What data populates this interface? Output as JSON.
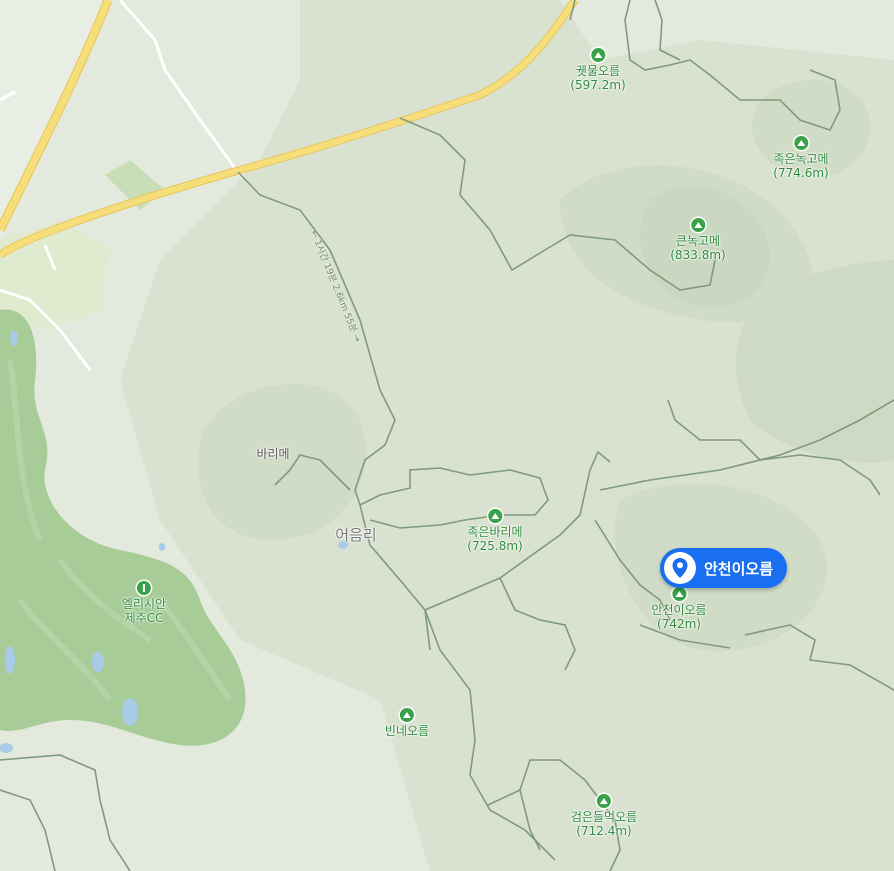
{
  "map": {
    "selected": {
      "name": "안천이오름"
    },
    "village": "어음리",
    "trail_label": "← 1시간 19분 2.6km 55분 →",
    "places": [
      {
        "id": "barime",
        "name": "바리메"
      }
    ],
    "peaks": [
      {
        "id": "kwemul",
        "name": "궷물오름",
        "elevation": "(597.2m)"
      },
      {
        "id": "jokeun-nokgome",
        "name": "족은녹고메",
        "elevation": "(774.6m)"
      },
      {
        "id": "keun-nokgome",
        "name": "큰녹고메",
        "elevation": "(833.8m)"
      },
      {
        "id": "jokeun-barime",
        "name": "족은바리메",
        "elevation": "(725.8m)"
      },
      {
        "id": "ancheoni",
        "name": "안천이오름",
        "elevation": "(742m)"
      },
      {
        "id": "binne",
        "name": "빈네오름",
        "elevation": ""
      },
      {
        "id": "geomeundeulmeok",
        "name": "검은들먹오름",
        "elevation": "(712.4m)"
      }
    ],
    "golf": {
      "line1": "엘리시안",
      "line2": "제주CC"
    },
    "colors": {
      "land": "#dfe6d7",
      "highland": "#d4dfcb",
      "golf_green": "#a7cc98",
      "highway": "#f6de7a",
      "pin": "#1a6ef0",
      "water": "#a9cbe8"
    }
  }
}
